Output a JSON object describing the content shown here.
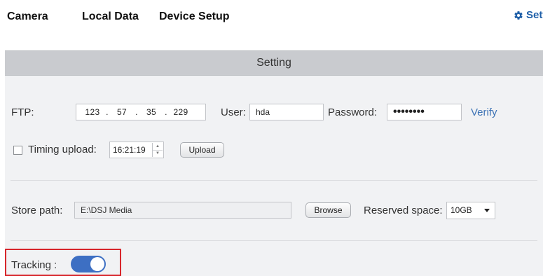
{
  "nav": {
    "camera": "Camera",
    "local_data": "Local Data",
    "device_setup": "Device Setup",
    "settings": "Sett"
  },
  "header": {
    "title": "Setting"
  },
  "ftp": {
    "label": "FTP:",
    "ip": [
      "123",
      "57",
      "35",
      "229"
    ],
    "ip_separator": ".",
    "user_label": "User:",
    "user_value": "hda",
    "password_label": "Password:",
    "password_value": "••••••••",
    "verify_label": "Verify"
  },
  "timing": {
    "checked": false,
    "label": "Timing upload:",
    "time_value": "16:21:19",
    "upload_label": "Upload"
  },
  "storage": {
    "store_label": "Store path:",
    "store_value": "E:\\DSJ Media",
    "browse_label": "Browse",
    "reserved_label": "Reserved space:",
    "reserved_value": "10GB"
  },
  "tracking": {
    "label": "Tracking :",
    "enabled": true
  },
  "icons": {
    "settings": "gear-icon",
    "time_up": "spinner-up-icon",
    "time_down": "spinner-down-icon",
    "dropdown": "chevron-down-icon"
  },
  "colors": {
    "link": "#3d73b5",
    "header_bar": "#c9cbcf",
    "panel_bg": "#f1f2f4",
    "toggle_on": "#3d6fc3",
    "highlight_border": "#d7262c"
  }
}
